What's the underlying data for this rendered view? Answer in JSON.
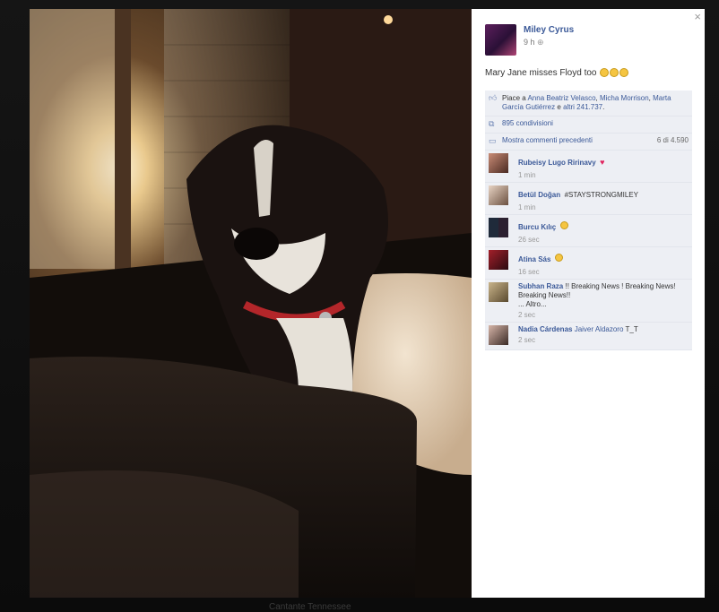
{
  "post": {
    "author": "Miley Cyrus",
    "time": "9 h",
    "text": "Mary Jane misses Floyd too",
    "close_label": "×"
  },
  "ufi": {
    "likes_prefix": "Piace a",
    "likes_name1": "Anna Beatriz Velasco",
    "likes_sep1": ",",
    "likes_name2": "Micha Morrison",
    "likes_sep2": ",",
    "likes_name3": "Marta García Gutiérrez",
    "likes_and": "e",
    "likes_others": "altri 241.737",
    "likes_end": ".",
    "shares": "895 condivisioni",
    "previous_comments": "Mostra commenti precedenti",
    "previous_count": "6 di 4.590"
  },
  "comments": [
    {
      "name": "Rubeisy Lugo Ririnavy",
      "text": "",
      "time": "1 min"
    },
    {
      "name": "Betül Doğan",
      "text": "#STAYSTRONGMILEY",
      "time": "1 min"
    },
    {
      "name": "Burcu Kılıç",
      "text": "",
      "time": "26 sec"
    },
    {
      "name": "Atina Sás",
      "text": "",
      "time": "16 sec"
    },
    {
      "name": "Subhan Raza",
      "text": "!! Breaking News ! Breaking News! Breaking News!!",
      "more": "... Altro...",
      "time": "2 sec"
    },
    {
      "name": "Nadia Cárdenas",
      "tag": "Jaiver Aldazoro",
      "text": "T_T",
      "time": "2 sec"
    }
  ],
  "background": {
    "footer_text": "Cantante Tennessee"
  },
  "icons": {
    "close": "close-icon",
    "privacy": "globe-icon",
    "like": "thumbs-up-icon",
    "share": "share-icon",
    "comment": "comment-bubble-icon",
    "heart": "heart-emoji",
    "smile": "smile-emoji"
  },
  "colors": {
    "link": "#3b5998",
    "ufi_bg": "#edeff4",
    "overlay": "#0c0c0c"
  }
}
